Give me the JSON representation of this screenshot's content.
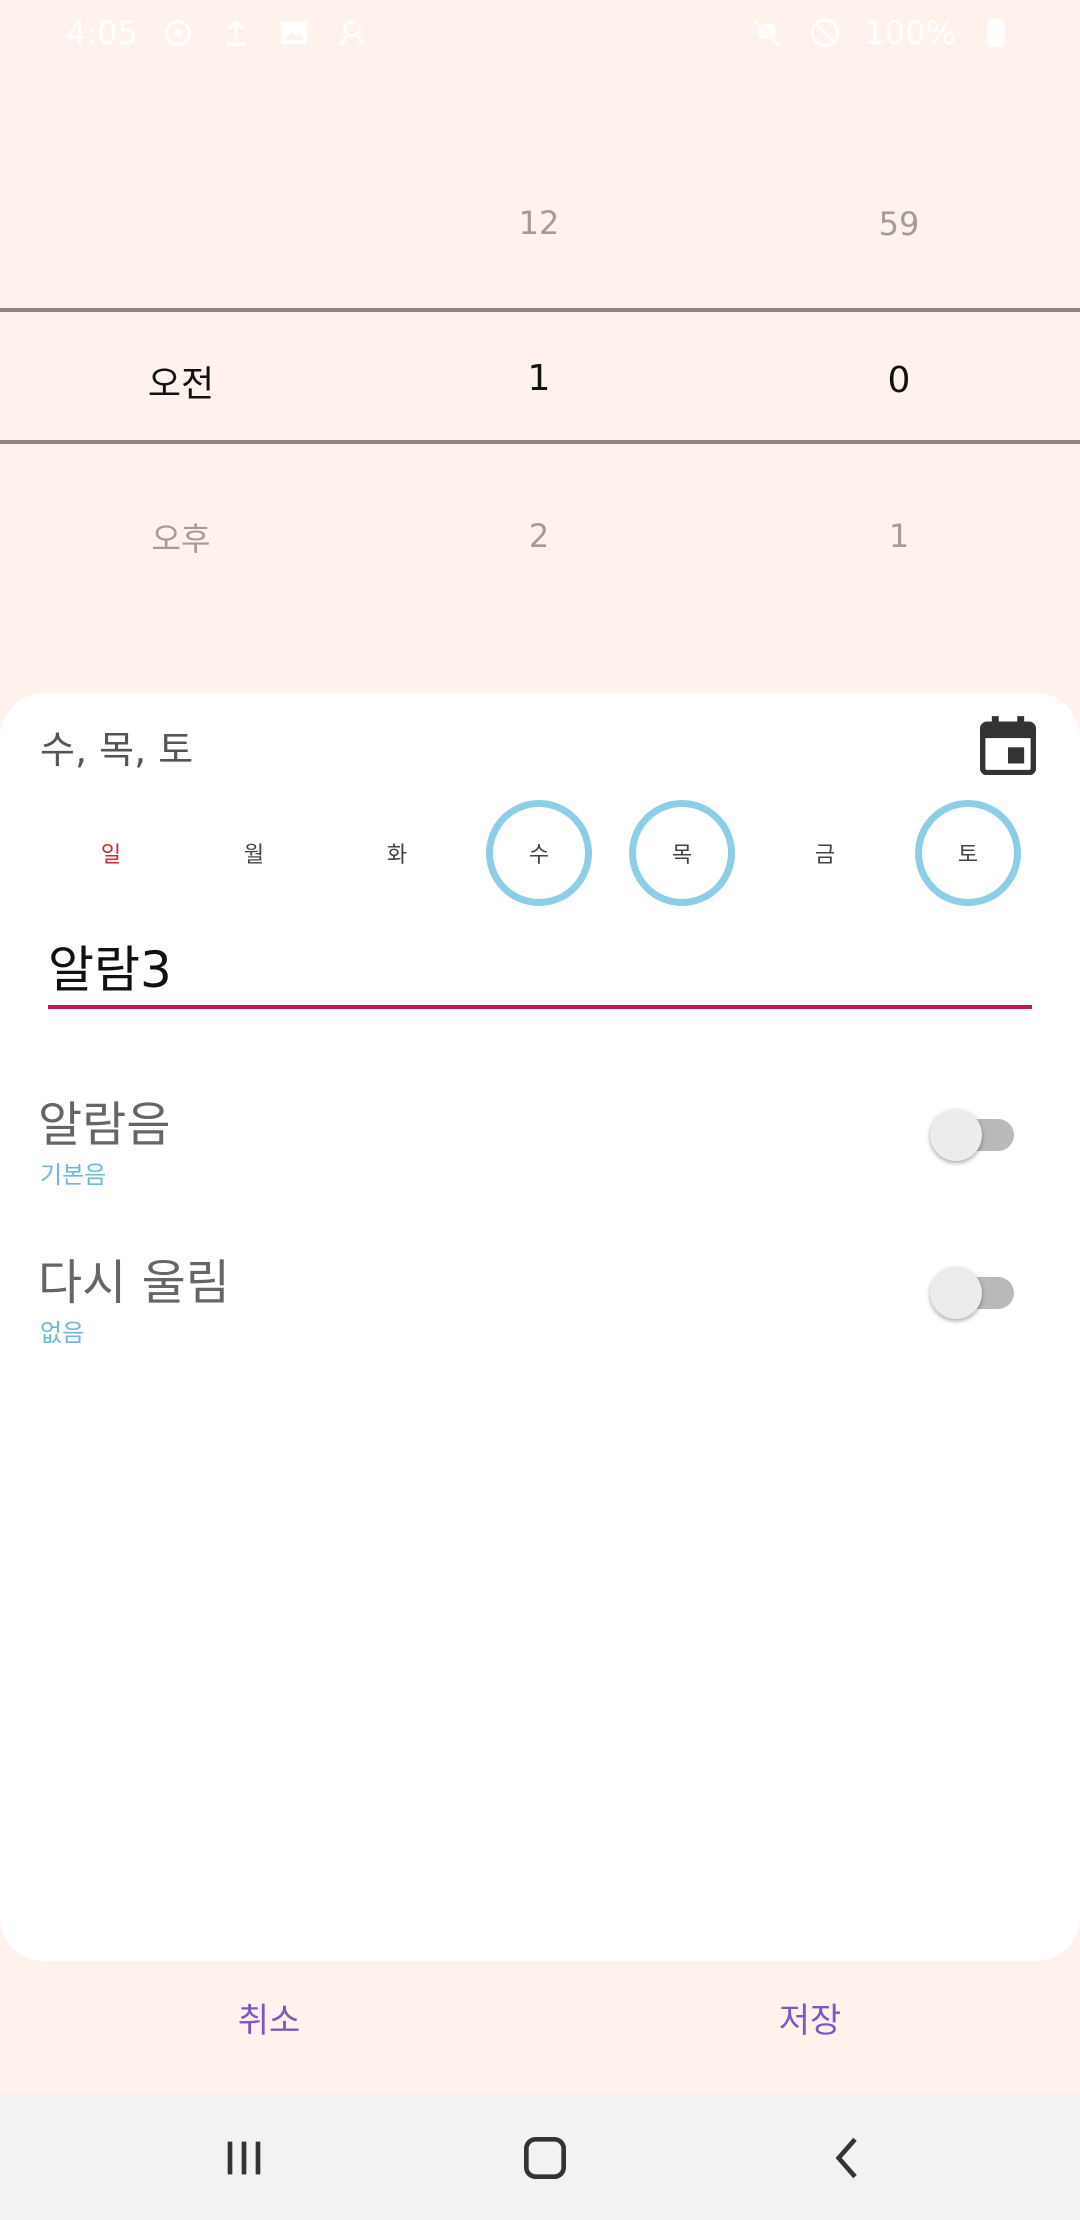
{
  "status_bar": {
    "time": "4:05",
    "battery": "100%",
    "icons_left": [
      "sync-icon",
      "upload-icon",
      "image-icon",
      "account-icon"
    ],
    "icons_right": [
      "mute-icon",
      "dnd-icon",
      "battery-icon"
    ]
  },
  "time_picker": {
    "period_column": {
      "above": "",
      "selected": "오전",
      "below": "오후"
    },
    "hour_column": {
      "above": "12",
      "selected": "1",
      "below": "2"
    },
    "minute_column": {
      "above": "59",
      "selected": "0",
      "below": "1"
    }
  },
  "days": {
    "summary": "수, 목, 토",
    "items": [
      {
        "label": "일",
        "selected": false
      },
      {
        "label": "월",
        "selected": false
      },
      {
        "label": "화",
        "selected": false
      },
      {
        "label": "수",
        "selected": true
      },
      {
        "label": "목",
        "selected": true
      },
      {
        "label": "금",
        "selected": false
      },
      {
        "label": "토",
        "selected": true
      }
    ]
  },
  "alarm_name": {
    "value": "알람3"
  },
  "settings": {
    "sound": {
      "title": "알람음",
      "subtitle": "기본음",
      "enabled": false
    },
    "snooze": {
      "title": "다시 울림",
      "subtitle": "없음",
      "enabled": false
    }
  },
  "actions": {
    "cancel": "취소",
    "save": "저장"
  },
  "nav": {
    "recents": "recents-icon",
    "home": "home-icon",
    "back": "back-icon"
  },
  "colors": {
    "background": "#fff1ec",
    "accent_underline": "#c2185b",
    "selected_day_ring": "#8ecde6",
    "sunday_text": "#d0262f",
    "action_text": "#7e57c2",
    "subtitle_text": "#6fb9d8"
  }
}
